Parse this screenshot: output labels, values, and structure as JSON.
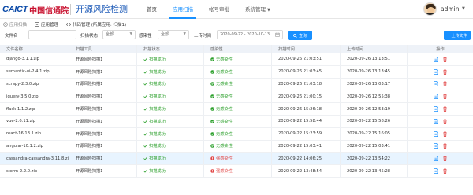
{
  "header": {
    "logo_en": "CAICT",
    "logo_cn": "中国信通院",
    "app_title": "开源风险检测",
    "nav": [
      {
        "label": "首页",
        "active": false
      },
      {
        "label": "应用扫描",
        "active": true
      },
      {
        "label": "帐号审批",
        "active": false
      },
      {
        "label": "系统管理",
        "active": false,
        "dropdown": true
      }
    ],
    "user": "admin"
  },
  "tabs": [
    {
      "label": "应用扫描",
      "active": false
    },
    {
      "label": "应用管理",
      "active": true
    },
    {
      "label": "代码管理 (所属应用: 扫描1)",
      "active": false
    }
  ],
  "filter": {
    "file_name_label": "文件名",
    "file_name_value": "",
    "scan_status_label": "扫描状态",
    "scan_status_value": "全部",
    "infection_label": "感染性",
    "infection_value": "全部",
    "upload_time_label": "上传时间",
    "date_range": "2020-09-22 - 2020-10-13",
    "query_button": "查询",
    "upload_button": "上传文件"
  },
  "table": {
    "columns": [
      "文件名称",
      "扫描工具",
      "扫描状态",
      "感染性",
      "扫描时间",
      "上传时间",
      "操作"
    ],
    "rows": [
      {
        "name": "django-3.1.1.zip",
        "tool": "开源风险扫描1",
        "status": "扫描成功",
        "infection": "无感染性",
        "scan_time": "2020-09-26 21:03:51",
        "upload_time": "2020-09-26 13:13:51",
        "infected": false,
        "highlight": false
      },
      {
        "name": "semantic-ui-2.4.1.zip",
        "tool": "开源风险扫描1",
        "status": "扫描成功",
        "infection": "无感染性",
        "scan_time": "2020-09-26 21:03:45",
        "upload_time": "2020-09-26 13:13:45",
        "infected": false,
        "highlight": false
      },
      {
        "name": "scrapy-2.3.0.zip",
        "tool": "开源风险扫描1",
        "status": "扫描成功",
        "infection": "无感染性",
        "scan_time": "2020-09-26 21:03:18",
        "upload_time": "2020-09-26 13:03:17",
        "infected": false,
        "highlight": false
      },
      {
        "name": "jquery-3.5.0.zip",
        "tool": "开源风险扫描1",
        "status": "扫描成功",
        "infection": "无感染性",
        "scan_time": "2020-09-26 21:00:15",
        "upload_time": "2020-09-26 12:55:38",
        "infected": false,
        "highlight": false
      },
      {
        "name": "flask-1.1.2.zip",
        "tool": "开源风险扫描1",
        "status": "扫描成功",
        "infection": "无感染性",
        "scan_time": "2020-09-26 15:26:18",
        "upload_time": "2020-09-26 12:53:19",
        "infected": false,
        "highlight": false
      },
      {
        "name": "vue-2.6.11.zip",
        "tool": "开源风险扫描1",
        "status": "扫描成功",
        "infection": "无感染性",
        "scan_time": "2020-09-22 15:58:44",
        "upload_time": "2020-09-22 15:58:26",
        "infected": false,
        "highlight": false
      },
      {
        "name": "react-16.13.1.zip",
        "tool": "开源风险扫描1",
        "status": "扫描成功",
        "infection": "无感染性",
        "scan_time": "2020-09-22 15:23:59",
        "upload_time": "2020-09-22 15:16:05",
        "infected": false,
        "highlight": false
      },
      {
        "name": "angular-10.1.2.zip",
        "tool": "开源风险扫描1",
        "status": "扫描成功",
        "infection": "无感染性",
        "scan_time": "2020-09-22 15:03:41",
        "upload_time": "2020-09-22 15:03:41",
        "infected": false,
        "highlight": false
      },
      {
        "name": "cassandra-cassandra-3.11.8.zip",
        "tool": "开源风险扫描1",
        "status": "扫描成功",
        "infection": "强感染性",
        "scan_time": "2020-09-22 14:06:25",
        "upload_time": "2020-09-22 13:54:22",
        "infected": true,
        "highlight": true
      },
      {
        "name": "storm-2.2.0.zip",
        "tool": "开源风险扫描1",
        "status": "扫描成功",
        "infection": "强感染性",
        "scan_time": "2020-09-22 13:48:54",
        "upload_time": "2020-09-22 13:45:28",
        "infected": true,
        "highlight": false
      }
    ]
  },
  "colors": {
    "primary": "#1890ff",
    "success": "#2ca02c",
    "danger": "#e24a4a",
    "brand_blue": "#0b4aa8",
    "brand_red": "#c8102e"
  }
}
